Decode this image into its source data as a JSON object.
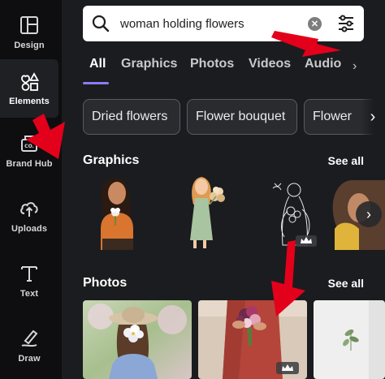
{
  "sidebar": {
    "items": [
      {
        "label": "Design",
        "icon": "layout-icon"
      },
      {
        "label": "Elements",
        "icon": "shapes-icon",
        "active": true
      },
      {
        "label": "Brand Hub",
        "icon": "brand-hub-icon"
      },
      {
        "label": "Uploads",
        "icon": "cloud-upload-icon"
      },
      {
        "label": "Text",
        "icon": "text-icon"
      },
      {
        "label": "Draw",
        "icon": "pen-icon"
      }
    ]
  },
  "search": {
    "value": "woman holding flowers"
  },
  "tabs": [
    "All",
    "Graphics",
    "Photos",
    "Videos",
    "Audio"
  ],
  "chips": [
    "Dried flowers",
    "Flower bouquet",
    "Flower"
  ],
  "sections": {
    "graphics": {
      "title": "Graphics",
      "see_all": "See all"
    },
    "photos": {
      "title": "Photos",
      "see_all": "See all"
    }
  },
  "colors": {
    "accent": "#8b7cf6",
    "annotation": "#e3001b"
  }
}
